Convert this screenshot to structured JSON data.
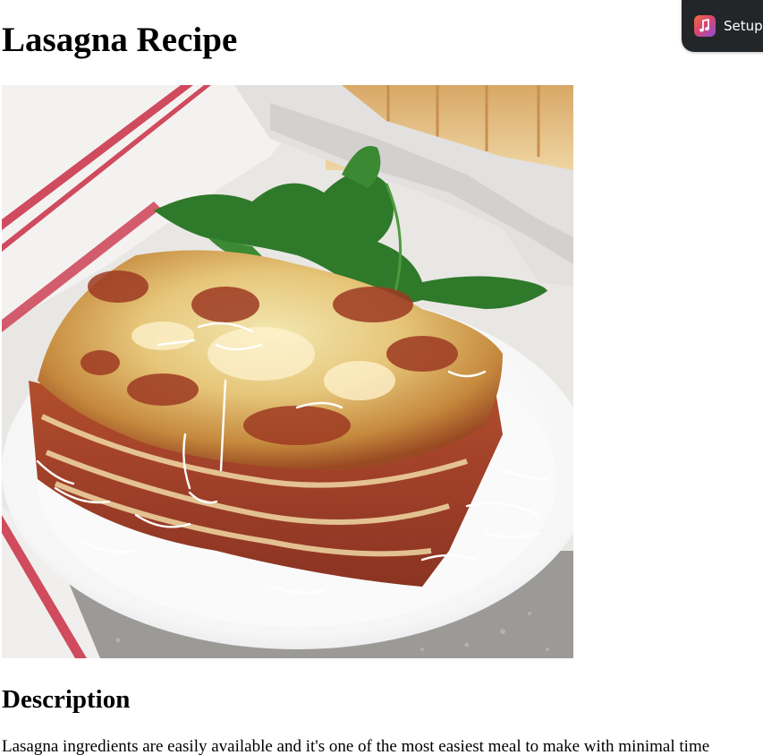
{
  "page": {
    "title": "Lasagna Recipe"
  },
  "hero_image": {
    "alt": "Lasagna Recipe"
  },
  "description": {
    "heading": "Description",
    "text": "Lasagna ingredients are easily available and it's one of the most easiest meal to make with minimal time"
  },
  "setup_widget": {
    "icon": "music-note-icon",
    "label": "Setup"
  }
}
